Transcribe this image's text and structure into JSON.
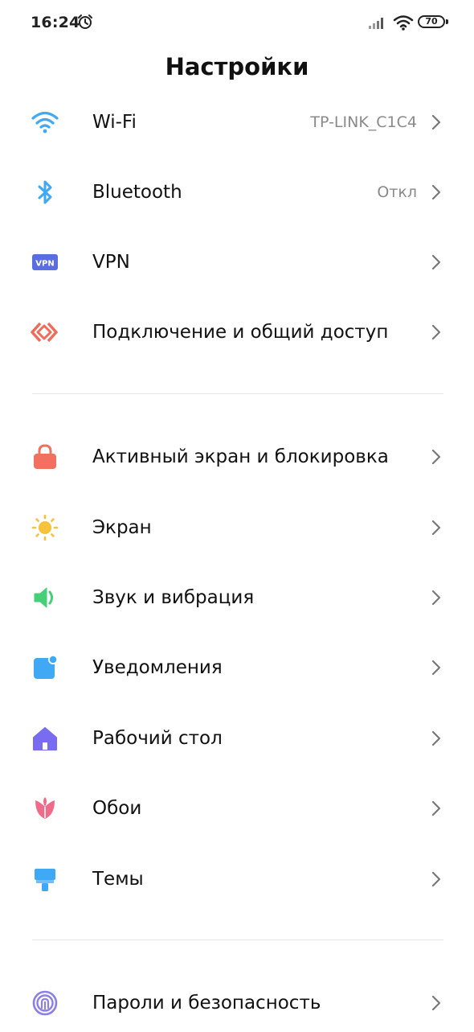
{
  "status_bar": {
    "time": "16:24",
    "battery": "70",
    "icons": [
      "alarm-icon",
      "signal-icon",
      "wifi-icon",
      "battery-icon"
    ]
  },
  "title": "Настройки",
  "items": [
    {
      "label": "Wi-Fi",
      "value": "TP-LINK_C1C4",
      "icon": "wifi-icon",
      "color": "#3fa9f5"
    },
    {
      "label": "Bluetooth",
      "value": "Откл",
      "icon": "bluetooth-icon",
      "color": "#3fa9f5"
    },
    {
      "label": "VPN",
      "value": "",
      "icon": "vpn-icon",
      "icon_text": "VPN",
      "color": "#5b6ee1"
    },
    {
      "label": "Подключение и общий доступ",
      "value": "",
      "icon": "connection-sharing-icon",
      "color": "#ef6b5a"
    },
    {
      "label": "Активный экран и блокировка",
      "value": "",
      "icon": "lock-icon",
      "color": "#f2705f"
    },
    {
      "label": "Экран",
      "value": "",
      "icon": "brightness-icon",
      "color": "#f7c23c"
    },
    {
      "label": "Звук и вибрация",
      "value": "",
      "icon": "sound-icon",
      "color": "#45cf78"
    },
    {
      "label": "Уведомления",
      "value": "",
      "icon": "notifications-icon",
      "color": "#3fa9f5"
    },
    {
      "label": "Рабочий стол",
      "value": "",
      "icon": "home-icon",
      "color": "#7a6cf0"
    },
    {
      "label": "Обои",
      "value": "",
      "icon": "wallpaper-flower-icon",
      "color": "#f06b8a"
    },
    {
      "label": "Темы",
      "value": "",
      "icon": "themes-brush-icon",
      "color": "#3fa9f5"
    },
    {
      "label": "Пароли и безопасность",
      "value": "",
      "icon": "fingerprint-icon",
      "color": "#8b7fe8"
    }
  ]
}
